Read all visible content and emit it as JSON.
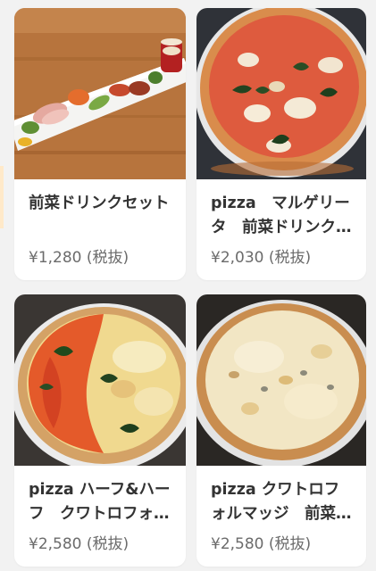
{
  "items": [
    {
      "name": "前菜ドリンクセット",
      "price": "¥1,280 (税抜)",
      "image": "antipasto-platter-with-drink"
    },
    {
      "name": "pizza　マルゲリータ　前菜ドリンクセット",
      "price": "¥2,030 (税抜)",
      "image": "pizza-margherita"
    },
    {
      "name": "pizza ハーフ&ハーフ　クワトロフォルマッジ",
      "price": "¥2,580 (税抜)",
      "image": "pizza-half-and-half"
    },
    {
      "name": "pizza クワトロフォルマッジ　前菜ドリンクセット",
      "price": "¥2,580 (税抜)",
      "image": "pizza-quattro-formaggi"
    }
  ],
  "colors": {
    "page_background": "#f2f2f2",
    "card_background": "#ffffff",
    "title_text": "#333333",
    "price_text": "#6b6b6b"
  }
}
